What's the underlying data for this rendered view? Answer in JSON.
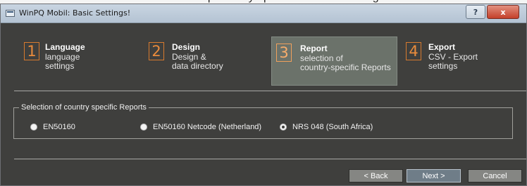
{
  "window": {
    "title": "WinPQ Mobil: Basic Settings!",
    "help_label": "?",
    "close_label": "x"
  },
  "steps": [
    {
      "number": "1",
      "title": "Language",
      "description": "language\nsettings",
      "active": false
    },
    {
      "number": "2",
      "title": "Design",
      "description": "Design &\ndata directory",
      "active": false
    },
    {
      "number": "3",
      "title": "Report",
      "description": "selection of\ncountry-specific Reports",
      "active": true
    },
    {
      "number": "4",
      "title": "Export",
      "description": "CSV - Export\nsettings",
      "active": false
    }
  ],
  "report_group": {
    "legend": "Selection of country specific Reports",
    "options": [
      {
        "label": "EN50160",
        "checked": false
      },
      {
        "label": "EN50160 Netcode (Netherland)",
        "checked": false
      },
      {
        "label": "NRS 048 (South Africa)",
        "checked": true
      }
    ]
  },
  "buttons": {
    "back": "< Back",
    "next": "Next >",
    "cancel": "Cancel"
  },
  "colors": {
    "window_bg": "#3f3f3d",
    "accent_number": "#e98b3c",
    "active_step_bg": "#6b726a",
    "next_button": "#6f7d88"
  }
}
